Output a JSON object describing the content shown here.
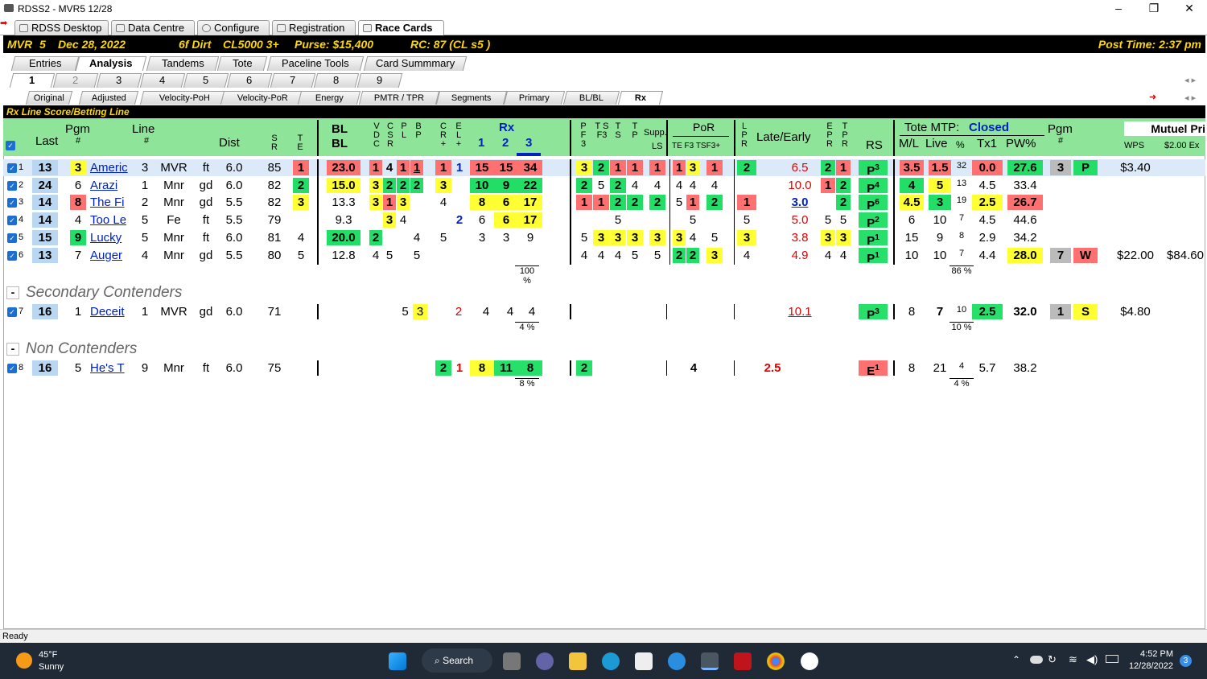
{
  "window": {
    "title": "RDSS2 - MVR5  12/28",
    "minimize": "–",
    "maximize": "❐",
    "close": "✕"
  },
  "main_tabs": [
    {
      "label": "RDSS Desktop"
    },
    {
      "label": "Data Centre"
    },
    {
      "label": "Configure"
    },
    {
      "label": "Registration"
    },
    {
      "label": "Race Cards"
    }
  ],
  "race": {
    "track": "MVR",
    "race_no": "5",
    "date": "Dec 28, 2022",
    "distance_surface": "6f  Dirt",
    "class": "CL5000  3+",
    "purse": "Purse: $15,400",
    "rc": "RC: 87  (CL s5 )",
    "post_time": "Post Time: 2:37 pm"
  },
  "view_tabs": [
    {
      "label": "Entries"
    },
    {
      "label": "Analysis"
    },
    {
      "label": "Tandems"
    },
    {
      "label": "Tote"
    },
    {
      "label": "Paceline Tools"
    },
    {
      "label": "Card Summmary"
    }
  ],
  "race_tabs": [
    {
      "label": "1"
    },
    {
      "label": "2"
    },
    {
      "label": "3"
    },
    {
      "label": "4"
    },
    {
      "label": "5"
    },
    {
      "label": "6"
    },
    {
      "label": "7"
    },
    {
      "label": "8"
    },
    {
      "label": "9"
    }
  ],
  "analysis_tabs": [
    {
      "label": "Original"
    },
    {
      "label": "Adjusted"
    },
    {
      "label": "Velocity-PoH"
    },
    {
      "label": "Velocity-PoR"
    },
    {
      "label": "Energy"
    },
    {
      "label": "PMTR / TPR"
    },
    {
      "label": "Segments"
    },
    {
      "label": "Primary"
    },
    {
      "label": "BL/BL"
    },
    {
      "label": "Rx"
    }
  ],
  "nav_arrows": "◂ ▸",
  "panel_title": "Rx Line Score/Betting Line",
  "headers": {
    "last": "Last",
    "pgm": "Pgm",
    "pgm_hash": "#",
    "line": "Line",
    "line_hash": "#",
    "dist": "Dist",
    "sr": "S R",
    "te": "T E",
    "blbl": "BL",
    "blbl2": "BL",
    "vdc": "V D C",
    "csr": "C S R",
    "pl": "P L",
    "bp": "B P",
    "cr": "C R +",
    "el": "E L +",
    "rx": "Rx",
    "rx1": "1",
    "rx2": "2",
    "rx3": "3",
    "pf3": "P F 3",
    "tsf3": "T S F3",
    "ts": "T S",
    "tp": "T P",
    "supp": "Supp.",
    "supp_ls": "LS",
    "por": "PoR",
    "por_sub": "TE F3 TSF3+",
    "lpr": "L P R",
    "late_early": "Late/Early",
    "epr": "E P R",
    "tpr": "T P R",
    "rs": "RS",
    "tote": "Tote MTP:",
    "tote_status": "Closed",
    "ml": "M/L",
    "live": "Live",
    "pct": "%",
    "tx1": "Tx1",
    "pw": "PW%",
    "pgm2": "Pgm",
    "pgm2_hash": "#",
    "mutuel": "Mutuel Pri",
    "wps": "WPS",
    "ex": "$2.00 Ex"
  },
  "contenders": [
    {
      "n": "1",
      "last": "13",
      "pgm": "3",
      "name": "Americ",
      "line": "3",
      "trk": "MVR",
      "surf": "ft",
      "dist": "6.0",
      "sr": "85",
      "te": "1",
      "bl": "23.0",
      "v": "1",
      "c": "4",
      "p": "1",
      "b": "1",
      "cr": "1",
      "el": "1",
      "rx1": "15",
      "rx2": "15",
      "rx3": "34",
      "pf": "3",
      "tsf": "2",
      "ts": "1",
      "tp": "1",
      "ls": "1",
      "te2": "1",
      "f3": "3",
      "tsf3": "1",
      "lpr": "2",
      "late": "6.5",
      "ep": "2",
      "tpr": "1",
      "rs": "P",
      "rs_sup": "3",
      "ml": "3.5",
      "live": "1.5",
      "pct": "32",
      "tx1": "0.0",
      "pw": "27.6",
      "pgm2": "3",
      "pos": "P",
      "wps": "$3.40",
      "ex": ""
    },
    {
      "n": "2",
      "last": "24",
      "pgm": "6",
      "name": "Arazi",
      "line": "1",
      "trk": "Mnr",
      "surf": "gd",
      "dist": "6.0",
      "sr": "82",
      "te": "2",
      "bl": "15.0",
      "v": "3",
      "c": "2",
      "p": "2",
      "b": "2",
      "cr": "3",
      "el": "",
      "rx1": "10",
      "rx2": "9",
      "rx3": "22",
      "pf": "2",
      "tsf": "5",
      "ts": "2",
      "tp": "4",
      "ls": "4",
      "te2": "4",
      "f3": "4",
      "tsf3": "4",
      "lpr": "",
      "late": "10.0",
      "ep": "1",
      "tpr": "2",
      "rs": "P",
      "rs_sup": "4",
      "ml": "4",
      "live": "5",
      "pct": "13",
      "tx1": "4.5",
      "pw": "33.4",
      "pgm2": "",
      "pos": "",
      "wps": "",
      "ex": ""
    },
    {
      "n": "3",
      "last": "14",
      "pgm": "8",
      "name": "The Fi",
      "line": "2",
      "trk": "Mnr",
      "surf": "gd",
      "dist": "5.5",
      "sr": "82",
      "te": "3",
      "bl": "13.3",
      "v": "3",
      "c": "1",
      "p": "3",
      "b": "",
      "cr": "4",
      "el": "",
      "rx1": "8",
      "rx2": "6",
      "rx3": "17",
      "pf": "1",
      "tsf": "1",
      "ts": "2",
      "tp": "2",
      "ls": "2",
      "te2": "5",
      "f3": "1",
      "tsf3": "2",
      "lpr": "1",
      "late": "3.0",
      "ep": "",
      "tpr": "2",
      "rs": "P",
      "rs_sup": "6",
      "ml": "4.5",
      "live": "3",
      "pct": "19",
      "tx1": "2.5",
      "pw": "26.7",
      "pgm2": "",
      "pos": "",
      "wps": "",
      "ex": ""
    },
    {
      "n": "4",
      "last": "14",
      "pgm": "4",
      "name": "Too Le",
      "line": "5",
      "trk": "Fe",
      "surf": "ft",
      "dist": "5.5",
      "sr": "79",
      "te": "",
      "bl": "9.3",
      "v": "",
      "c": "3",
      "p": "4",
      "b": "",
      "cr": "",
      "el": "2",
      "rx1": "6",
      "rx2": "6",
      "rx3": "17",
      "pf": "",
      "tsf": "",
      "ts": "5",
      "tp": "",
      "ls": "",
      "te2": "",
      "f3": "5",
      "tsf3": "",
      "lpr": "5",
      "late": "5.0",
      "ep": "5",
      "tpr": "5",
      "rs": "P",
      "rs_sup": "2",
      "ml": "6",
      "live": "10",
      "pct": "7",
      "tx1": "4.5",
      "pw": "44.6",
      "pgm2": "",
      "pos": "",
      "wps": "",
      "ex": ""
    },
    {
      "n": "5",
      "last": "15",
      "pgm": "9",
      "name": "Lucky",
      "line": "5",
      "trk": "Mnr",
      "surf": "ft",
      "dist": "6.0",
      "sr": "81",
      "te": "4",
      "bl": "20.0",
      "v": "2",
      "c": "",
      "p": "",
      "b": "4",
      "cr": "5",
      "el": "",
      "rx1": "3",
      "rx2": "3",
      "rx3": "9",
      "pf": "5",
      "tsf": "3",
      "ts": "3",
      "tp": "3",
      "ls": "3",
      "te2": "3",
      "f3": "4",
      "tsf3": "5",
      "lpr": "3",
      "late": "3.8",
      "ep": "3",
      "tpr": "3",
      "rs": "P",
      "rs_sup": "1",
      "ml": "15",
      "live": "9",
      "pct": "8",
      "tx1": "2.9",
      "pw": "34.2",
      "pgm2": "",
      "pos": "",
      "wps": "",
      "ex": ""
    },
    {
      "n": "6",
      "last": "13",
      "pgm": "7",
      "name": "Auger",
      "line": "4",
      "trk": "Mnr",
      "surf": "gd",
      "dist": "5.5",
      "sr": "80",
      "te": "5",
      "bl": "12.8",
      "v": "4",
      "c": "5",
      "p": "",
      "b": "5",
      "cr": "",
      "el": "",
      "rx1": "",
      "rx2": "",
      "rx3": "",
      "pf": "4",
      "tsf": "4",
      "ts": "4",
      "tp": "5",
      "ls": "5",
      "te2": "2",
      "f3": "2",
      "tsf3": "3",
      "lpr": "4",
      "late": "4.9",
      "ep": "4",
      "tpr": "4",
      "rs": "P",
      "rs_sup": "1",
      "ml": "10",
      "live": "10",
      "pct": "7",
      "tx1": "4.4",
      "pw": "28.0",
      "pgm2": "7",
      "pos": "W",
      "wps": "$22.00",
      "ex": "$84.60"
    }
  ],
  "contenders_pct": "100 %",
  "contenders_live_pct": "86 %",
  "secondary": {
    "title": "Secondary Contenders",
    "toggle": "-",
    "row": {
      "n": "7",
      "last": "16",
      "pgm": "1",
      "name": "Deceit",
      "line": "1",
      "trk": "MVR",
      "surf": "gd",
      "dist": "6.0",
      "sr": "71",
      "b": "5",
      "b2": "3",
      "cr": "2",
      "rx1": "4",
      "rx2": "4",
      "rx3": "4",
      "late": "10.1",
      "rs": "P",
      "rs_sup": "3",
      "ml": "8",
      "live": "7",
      "pct": "10",
      "tx1": "2.5",
      "pw": "32.0",
      "pgm2": "1",
      "pos": "S",
      "wps": "$4.80"
    },
    "pct": "4 %",
    "live_pct": "10 %"
  },
  "non": {
    "title": "Non Contenders",
    "toggle": "-",
    "row": {
      "n": "8",
      "last": "16",
      "pgm": "5",
      "name": "He's T",
      "line": "9",
      "trk": "Mnr",
      "surf": "ft",
      "dist": "6.0",
      "sr": "75",
      "cr": "2",
      "el": "1",
      "rx1": "8",
      "rx2": "11",
      "rx3": "8",
      "pf": "2",
      "f3": "4",
      "late": "2.5",
      "rs": "E",
      "rs_sup": "1",
      "ml": "8",
      "live": "21",
      "pct": "4",
      "tx1": "5.7",
      "pw": "38.2"
    },
    "pct": "8 %",
    "live_pct": "4 %"
  },
  "status": "Ready",
  "taskbar": {
    "temp": "45°F",
    "weather": "Sunny",
    "search": "Search",
    "time": "4:52 PM",
    "date": "12/28/2022",
    "badge": "3"
  }
}
